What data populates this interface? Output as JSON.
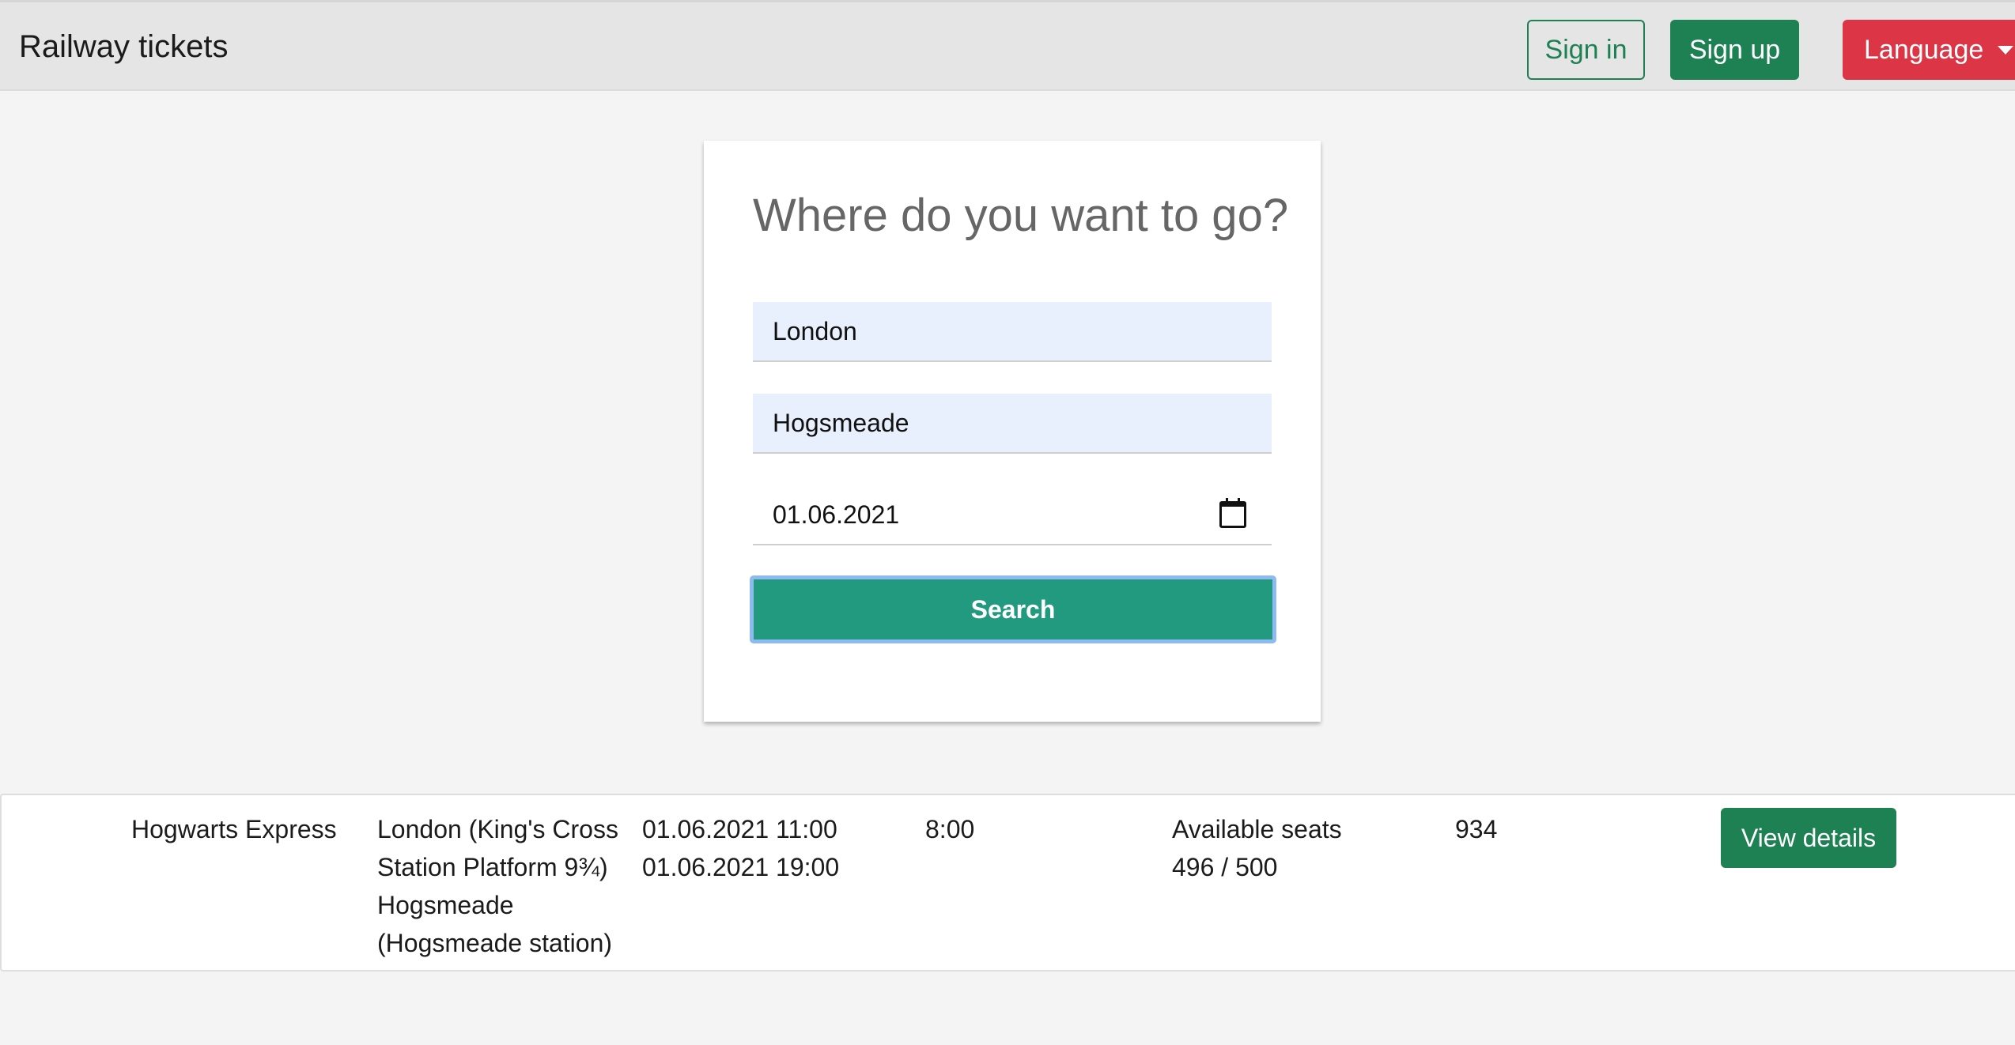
{
  "navbar": {
    "brand": "Railway tickets",
    "sign_in": "Sign in",
    "sign_up": "Sign up",
    "language": "Language"
  },
  "search": {
    "title": "Where do you want to go?",
    "from_value": "London",
    "to_value": "Hogsmeade",
    "date_value": "01.06.2021",
    "submit_label": "Search"
  },
  "results": [
    {
      "train": "Hogwarts Express",
      "route_lines": [
        "London (King's Cross",
        "Station Platform 9¾)",
        "Hogsmeade",
        "(Hogsmeade station)"
      ],
      "departure": "01.06.2021 11:00",
      "arrival": "01.06.2021 19:00",
      "duration": "8:00",
      "seats_label": "Available seats",
      "seats_value": "496 / 500",
      "price": "934",
      "details_label": "View details"
    }
  ],
  "colors": {
    "primary_green": "#1e8153",
    "search_teal": "#229a7f",
    "language_red": "#dc3545",
    "autofill_blue": "#e8f0fe"
  }
}
